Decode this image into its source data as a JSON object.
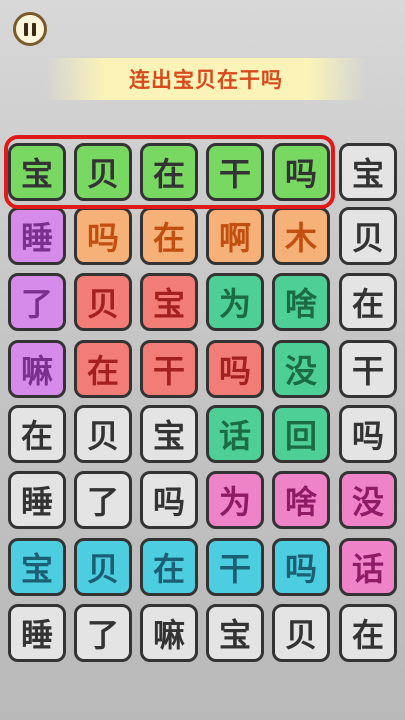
{
  "header": {
    "pause_icon": "pause-icon",
    "banner_text": "连出宝贝在干吗"
  },
  "board": {
    "rows": [
      [
        {
          "t": "宝",
          "c": "green"
        },
        {
          "t": "贝",
          "c": "green"
        },
        {
          "t": "在",
          "c": "green"
        },
        {
          "t": "干",
          "c": "green"
        },
        {
          "t": "吗",
          "c": "green"
        },
        {
          "t": "宝",
          "c": "gray"
        }
      ],
      [
        {
          "t": "睡",
          "c": "purple"
        },
        {
          "t": "吗",
          "c": "orange"
        },
        {
          "t": "在",
          "c": "orange"
        },
        {
          "t": "啊",
          "c": "orange"
        },
        {
          "t": "木",
          "c": "orange"
        },
        {
          "t": "贝",
          "c": "gray"
        }
      ],
      [
        {
          "t": "了",
          "c": "purple"
        },
        {
          "t": "贝",
          "c": "red"
        },
        {
          "t": "宝",
          "c": "red"
        },
        {
          "t": "为",
          "c": "teal"
        },
        {
          "t": "啥",
          "c": "teal"
        },
        {
          "t": "在",
          "c": "gray"
        }
      ],
      [
        {
          "t": "嘛",
          "c": "purple"
        },
        {
          "t": "在",
          "c": "red"
        },
        {
          "t": "干",
          "c": "red"
        },
        {
          "t": "吗",
          "c": "red"
        },
        {
          "t": "没",
          "c": "teal"
        },
        {
          "t": "干",
          "c": "gray"
        }
      ],
      [
        {
          "t": "在",
          "c": "gray"
        },
        {
          "t": "贝",
          "c": "gray"
        },
        {
          "t": "宝",
          "c": "gray"
        },
        {
          "t": "话",
          "c": "teal"
        },
        {
          "t": "回",
          "c": "teal"
        },
        {
          "t": "吗",
          "c": "gray"
        }
      ],
      [
        {
          "t": "睡",
          "c": "gray"
        },
        {
          "t": "了",
          "c": "gray"
        },
        {
          "t": "吗",
          "c": "gray"
        },
        {
          "t": "为",
          "c": "pink"
        },
        {
          "t": "啥",
          "c": "pink"
        },
        {
          "t": "没",
          "c": "pink"
        }
      ],
      [
        {
          "t": "宝",
          "c": "blue"
        },
        {
          "t": "贝",
          "c": "blue"
        },
        {
          "t": "在",
          "c": "blue"
        },
        {
          "t": "干",
          "c": "blue"
        },
        {
          "t": "吗",
          "c": "blue"
        },
        {
          "t": "话",
          "c": "pink"
        }
      ],
      [
        {
          "t": "睡",
          "c": "gray"
        },
        {
          "t": "了",
          "c": "gray"
        },
        {
          "t": "嘛",
          "c": "gray"
        },
        {
          "t": "宝",
          "c": "gray"
        },
        {
          "t": "贝",
          "c": "gray"
        },
        {
          "t": "在",
          "c": "gray"
        }
      ]
    ]
  },
  "colors": {
    "highlight": "#e01a1a",
    "banner_text": "#d64a1c"
  }
}
